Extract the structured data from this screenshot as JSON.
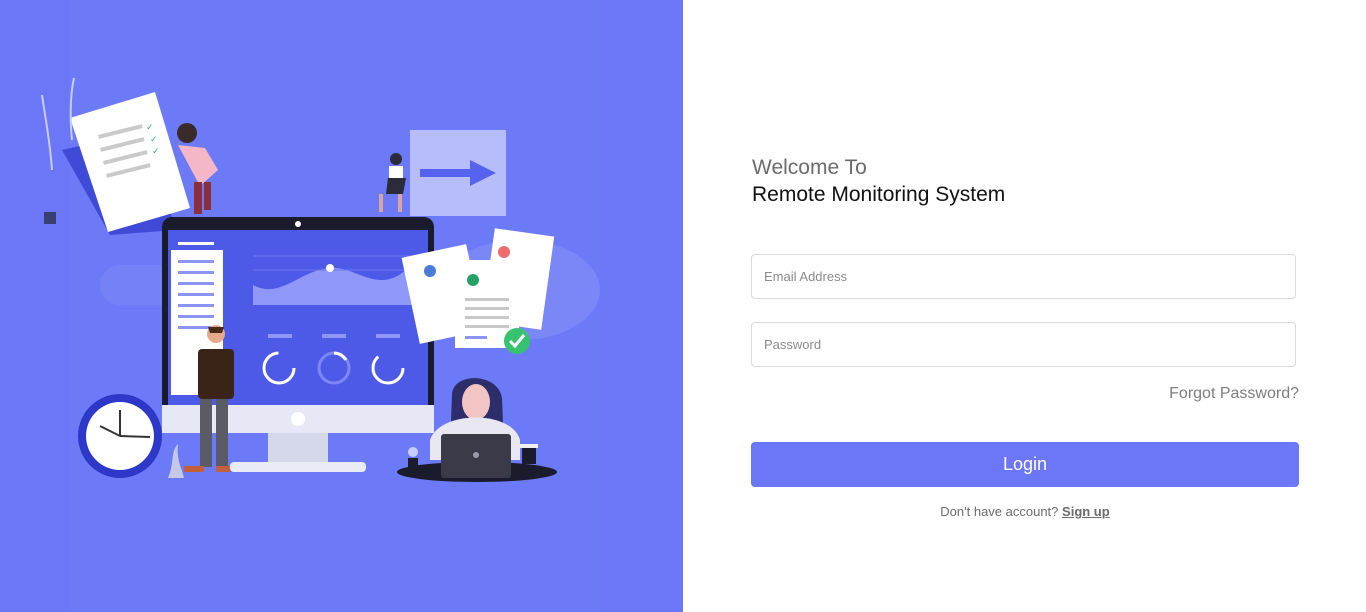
{
  "brand": {
    "accent": "#6b77f7",
    "panel_bg": "#ffffff",
    "field_border": "#d9d9d9"
  },
  "heading": {
    "welcome": "Welcome To",
    "system_name": "Remote Monitoring System"
  },
  "form": {
    "email": {
      "placeholder": "Email Address",
      "value": ""
    },
    "password": {
      "placeholder": "Password",
      "value": ""
    },
    "forgot_label": "Forgot Password?",
    "login_label": "Login",
    "signup_prompt": "Don't have account?",
    "signup_label": "Sign up"
  },
  "illustration": {
    "icons": [
      "document-icon",
      "arrow-right-icon",
      "monitor-icon",
      "clock-icon",
      "laptop-icon",
      "checkmark-icon",
      "plant-icon",
      "coffee-cup-icon"
    ]
  }
}
